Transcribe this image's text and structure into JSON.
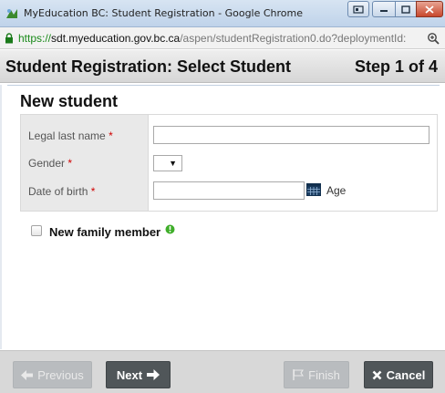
{
  "window": {
    "title": "MyEducation BC: Student Registration - Google Chrome"
  },
  "address": {
    "scheme": "https://",
    "domain": "sdt.myeducation.gov.bc.ca",
    "path": "/aspen/studentRegistration0.do?deploymentId:"
  },
  "dialog": {
    "title": "Student Registration: Select Student",
    "step": "Step 1 of 4"
  },
  "section": {
    "title": "New student"
  },
  "form": {
    "last_name_label": "Legal last name",
    "gender_label": "Gender",
    "dob_label": "Date of birth",
    "required_mark": "*",
    "age_label": "Age",
    "gender_value": "",
    "last_name_value": "",
    "dob_value": ""
  },
  "family": {
    "label": "New family member"
  },
  "footer": {
    "previous_label": "Previous",
    "next_label": "Next",
    "finish_label": "Finish",
    "cancel_label": "Cancel"
  },
  "colors": {
    "required": "#d00000",
    "button_dark": "#505659",
    "button_disabled": "#b9bcbf",
    "info_green": "#3fae2a"
  }
}
